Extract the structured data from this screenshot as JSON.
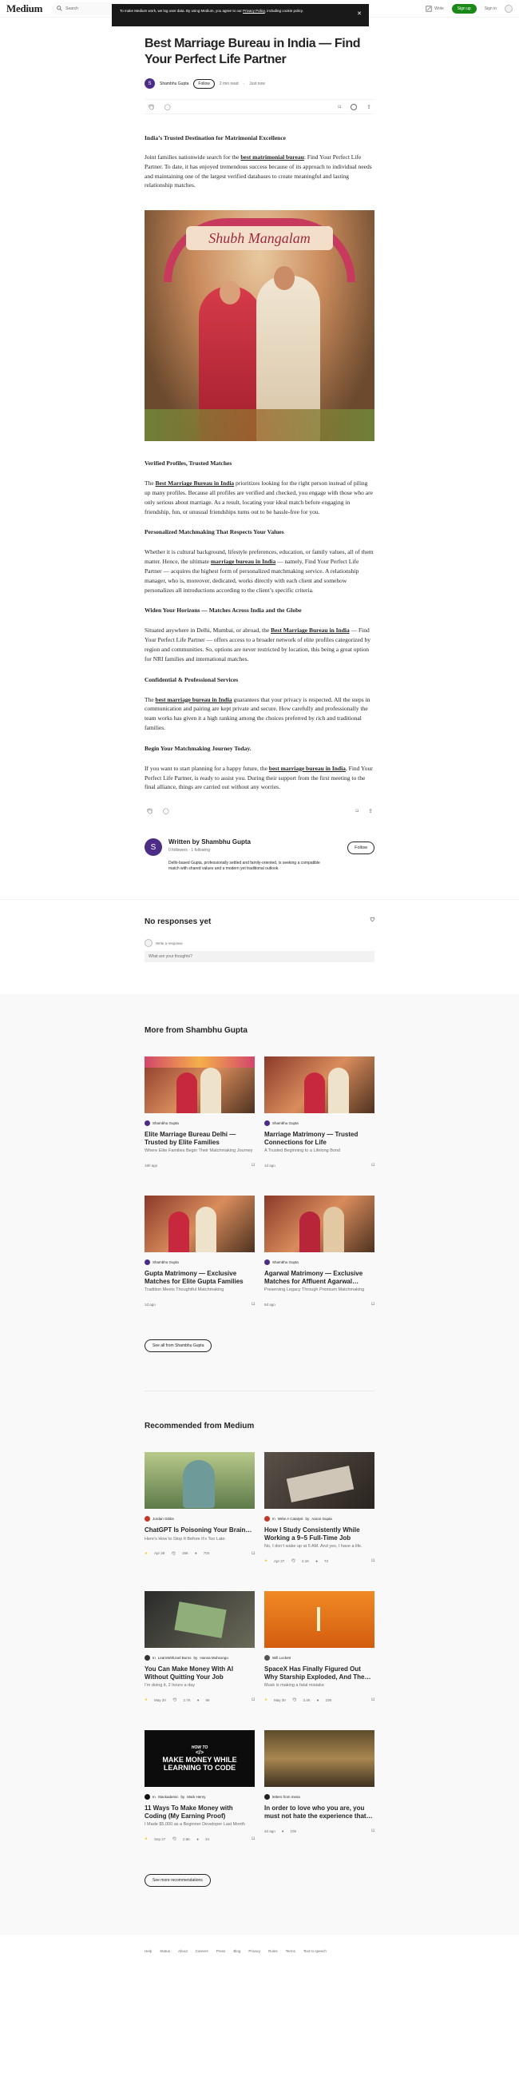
{
  "header": {
    "logo": "Medium",
    "search_placeholder": "Search",
    "write": "Write",
    "sign_up": "Sign up",
    "sign_in": "Sign in"
  },
  "cookie": {
    "text": "To make Medium work, we log user data. By using Medium, you agree to our",
    "link": "Privacy Policy",
    "text2": ", including cookie policy."
  },
  "article": {
    "title": "Best Marriage Bureau in India — Find Your Perfect Life Partner",
    "author": "Shambhu Gupta",
    "follow": "Follow",
    "read_time": "2 min read",
    "sep": "·",
    "date": "Just now",
    "h_intro": "India’s Trusted Destination for Matrimonial Excellence",
    "p1_a": "Joint families nationwide search for the ",
    "p1_link": "best matrimonial bureau",
    "p1_b": ": Find Your Perfect Life Partner. To date, it has enjoyed tremendous success because of its approach to individual needs and maintaining one of the largest verified databases to create meaningful and lasting relationship matches.",
    "hero_sign": "Shubh Mangalam",
    "h2": "Verified Profiles, Trusted Matches",
    "p2_a": "The ",
    "p2_link": "Best Marriage Bureau in India",
    "p2_b": " prioritizes looking for the right person instead of piling up many profiles. Because all profiles are verified and checked, you engage with those who are only serious about marriage. As a result, locating your ideal match before engaging in friendship, fun, or unusual friendships turns out to be hassle-free for you.",
    "h3": "Personalized Matchmaking That Respects Your Values",
    "p3_a": "Whether it is cultural background, lifestyle preferences, education, or family values, all of them matter. Hence, the ultimate ",
    "p3_link": "marriage bureau in India",
    "p3_b": " — namely, Find Your Perfect Life Partner — acquires the highest form of personalized matchmaking service. A relationship manager, who is, moreover, dedicated, works directly with each client and somehow personalizes all introductions according to the client’s specific criteria.",
    "h4": "Widen Your Horizons — Matches Across India and the Globe",
    "p4_a": "Situated anywhere in Delhi, Mumbai, or abroad, the ",
    "p4_link": "Best Marriage Bureau in India",
    "p4_b": " — Find Your Perfect Life Partner — offers access to a broader network of elite profiles categorized by region and communities. So, options are never restricted by location, this being a great option for NRI families and international matches.",
    "h5": "Confidential & Professional Services",
    "p5_a": "The ",
    "p5_link": "best marriage bureau in India",
    "p5_b": " guarantees that your privacy is respected. All the steps in communication and pairing are kept private and secure. How carefully and professionally the team works has given it a high ranking among the choices preferred by rich and traditional families.",
    "h6": "Begin Your Matchmaking Journey Today.",
    "p6_a": "If you want to start planning for a happy future, the ",
    "p6_link": "best marriage bureau in India",
    "p6_b": ", Find Your Perfect Life Partner, is ready to assist you. During their support from the first meeting to the final alliance, things are carried out without any worries."
  },
  "writer": {
    "initial": "S",
    "name": "Written by Shambhu Gupta",
    "followers": "0 followers",
    "following": "1 following",
    "dot": "·",
    "bio": "Delhi-based Gupta, professionally settled and family-oriented, is seeking a compatible match with shared values and a modern yet traditional outlook.",
    "follow": "Follow"
  },
  "responses": {
    "title": "No responses yet",
    "write_label": "Write a response",
    "placeholder": "What are your thoughts?"
  },
  "more": {
    "title": "More from Shambhu Gupta",
    "cards": [
      {
        "author": "Shambhu Gupta",
        "title": "Elite Marriage Bureau Delhi — Trusted by Elite Families",
        "sub": "Where Elite Families Begin Their Matchmaking Journey",
        "date": "16h ago"
      },
      {
        "author": "Shambhu Gupta",
        "title": "Marriage Matrimony — Trusted Connections for Life",
        "sub": "A Trusted Beginning to a Lifelong Bond",
        "date": "1d ago"
      },
      {
        "author": "Shambhu Gupta",
        "title": "Gupta Matrimony — Exclusive Matches for Elite Gupta Families",
        "sub": "Tradition Meets Thoughtful Matchmaking",
        "date": "1d ago"
      },
      {
        "author": "Shambhu Gupta",
        "title": "Agarwal Matrimony — Exclusive Matches for Affluent Agarwal…",
        "sub": "Preserving Legacy Through Premium Matchmaking",
        "date": "5d ago"
      }
    ],
    "see_all": "See all from Shambhu Gupta"
  },
  "recommended": {
    "title": "Recommended from Medium",
    "cards": [
      {
        "author": "Jordan Gibbs",
        "in": "",
        "title": "ChatGPT Is Poisoning Your Brain…",
        "sub": "Here’s How to Stop It Before It’s Too Late.",
        "date": "Apr 28",
        "claps": "15K",
        "comments": "704"
      },
      {
        "author": "Write A Catalyst",
        "in": "In",
        "by": "Aaron Gupta",
        "title": "How I Study Consistently While Working a 9–5 Full-Time Job",
        "sub": "No, I don’t wake up at 5 AM. And yes, I have a life.",
        "date": "Apr 27",
        "claps": "2.1K",
        "comments": "73"
      },
      {
        "author": "LearnWithJoel Burns",
        "in": "In",
        "by": "Hanna Muhsongo",
        "title": "You Can Make Money With AI Without Quitting Your Job",
        "sub": "I’m doing it, 2 hours a day",
        "date": "May 20",
        "claps": "2.7K",
        "comments": "66"
      },
      {
        "author": "Will Lockett",
        "in": "",
        "title": "SpaceX Has Finally Figured Out Why Starship Exploded, And The…",
        "sub": "Musk is making a fatal mistake",
        "date": "May 30",
        "claps": "3.4K",
        "comments": "108"
      },
      {
        "author": "Stackademic",
        "in": "In",
        "by": "Mark Henry",
        "title": "11 Ways To Make Money with Coding (My Earning Proof)",
        "sub": "I Made $5,000 as a Beginner Developer Last Month",
        "date": "Sep 27",
        "claps": "2.8K",
        "comments": "34",
        "img_t1": "HOW TO",
        "img_t2": "</>",
        "img_t3": "MAKE MONEY WHILE LEARNING TO CODE"
      },
      {
        "author": "letters from mesa",
        "in": "",
        "title": "In order to love who you are, you must not hate the experience that…",
        "sub": "",
        "date": "4d ago",
        "claps": "",
        "comments": "105"
      }
    ],
    "see_more": "See more recommendations"
  },
  "footer": [
    "Help",
    "Status",
    "About",
    "Careers",
    "Press",
    "Blog",
    "Privacy",
    "Rules",
    "Terms",
    "Text to speech"
  ],
  "colors": {
    "accent": "#1a8917",
    "text": "#242424",
    "muted": "#6b6b6b"
  }
}
